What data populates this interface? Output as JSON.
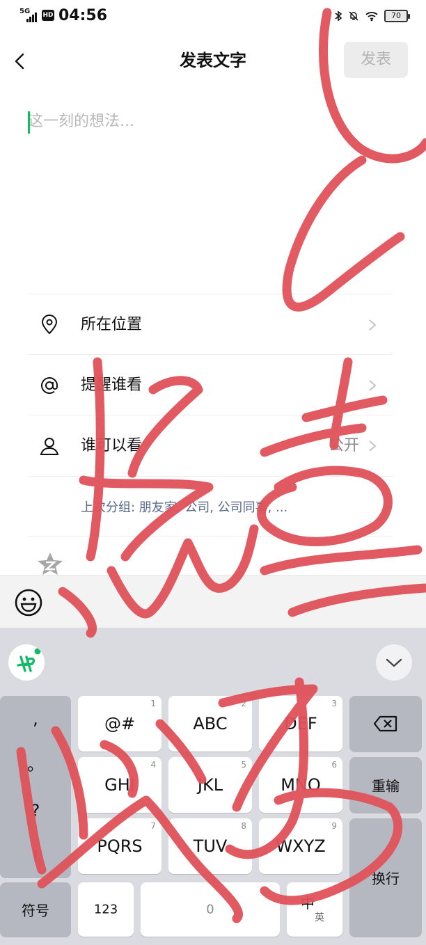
{
  "status_bar": {
    "network": "5G",
    "hd": "HD",
    "time": "04:56",
    "battery": "70"
  },
  "nav": {
    "title": "发表文字",
    "publish_label": "发表"
  },
  "compose": {
    "placeholder": "这一刻的想法..."
  },
  "options": [
    {
      "label": "所在位置",
      "value": ""
    },
    {
      "label": "提醒谁看",
      "value": ""
    },
    {
      "label": "谁可以看",
      "value": "公开"
    }
  ],
  "recent_groups": "上次分组: 朋友家, 公司, 公司同事, ...",
  "keyboard": {
    "punct": [
      ",",
      "。",
      "?",
      "!"
    ],
    "rows": [
      [
        {
          "label": "@#",
          "num": "1"
        },
        {
          "label": "ABC",
          "num": "2"
        },
        {
          "label": "DEF",
          "num": "3"
        }
      ],
      [
        {
          "label": "GHI",
          "num": "4"
        },
        {
          "label": "JKL",
          "num": "5"
        },
        {
          "label": "MNO",
          "num": "6"
        }
      ],
      [
        {
          "label": "PQRS",
          "num": "7"
        },
        {
          "label": "TUV",
          "num": "8"
        },
        {
          "label": "WXYZ",
          "num": "9"
        }
      ]
    ],
    "reenter": "重输",
    "newline": "换行",
    "symbols": "符号",
    "num_key": "123",
    "space": "0",
    "lang_main": "中",
    "lang_sub": "英"
  },
  "colors": {
    "accent": "#07c160",
    "scribble": "#e0525a",
    "link": "#57698b"
  }
}
